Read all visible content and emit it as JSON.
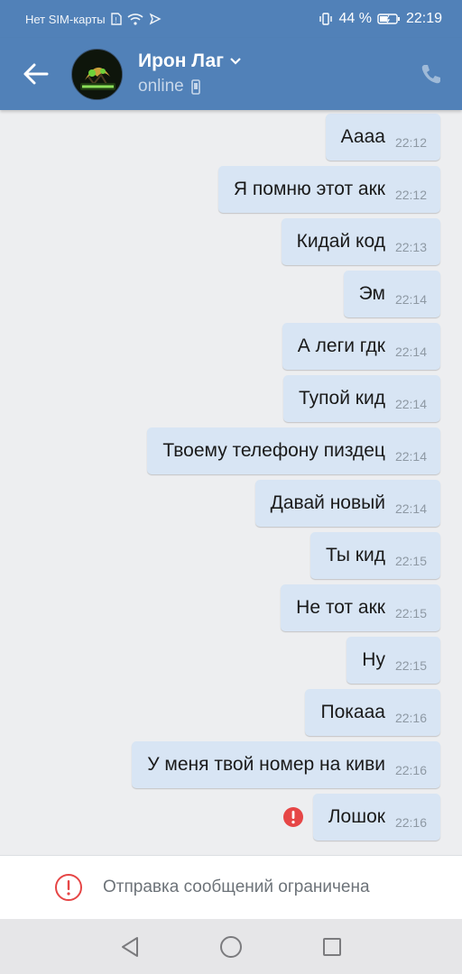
{
  "status_bar": {
    "carrier": "Нет SIM-карты",
    "battery": "44 %",
    "time": "22:19"
  },
  "header": {
    "title": "Ирон Лаг",
    "status": "online"
  },
  "messages": [
    {
      "text": "Аааа",
      "time": "22:12"
    },
    {
      "text": "Я помню этот акк",
      "time": "22:12"
    },
    {
      "text": "Кидай код",
      "time": "22:13"
    },
    {
      "text": "Эм",
      "time": "22:14"
    },
    {
      "text": "А леги гдк",
      "time": "22:14"
    },
    {
      "text": "Тупой кид",
      "time": "22:14"
    },
    {
      "text": "Твоему телефону пиздец",
      "time": "22:14"
    },
    {
      "text": "Давай новый",
      "time": "22:14"
    },
    {
      "text": "Ты кид",
      "time": "22:15"
    },
    {
      "text": "Не тот акк",
      "time": "22:15"
    },
    {
      "text": "Ну",
      "time": "22:15"
    },
    {
      "text": "Покааа",
      "time": "22:16"
    },
    {
      "text": "У меня твой номер на киви",
      "time": "22:16"
    },
    {
      "text": "Лошок",
      "time": "22:16",
      "failed": true
    }
  ],
  "restriction": {
    "text": "Отправка сообщений ограничена"
  },
  "colors": {
    "header_bg": "#5181b8",
    "bubble_bg": "#d8e5f4",
    "error_red": "#e64646"
  },
  "icons": {
    "back": "arrow-left-icon",
    "dropdown": "chevron-down-icon",
    "mobile": "phone-device-icon",
    "call": "phone-call-icon",
    "error": "exclamation-circle-icon",
    "nav_back": "triangle-back-icon",
    "nav_home": "circle-home-icon",
    "nav_recent": "square-recent-icon"
  }
}
